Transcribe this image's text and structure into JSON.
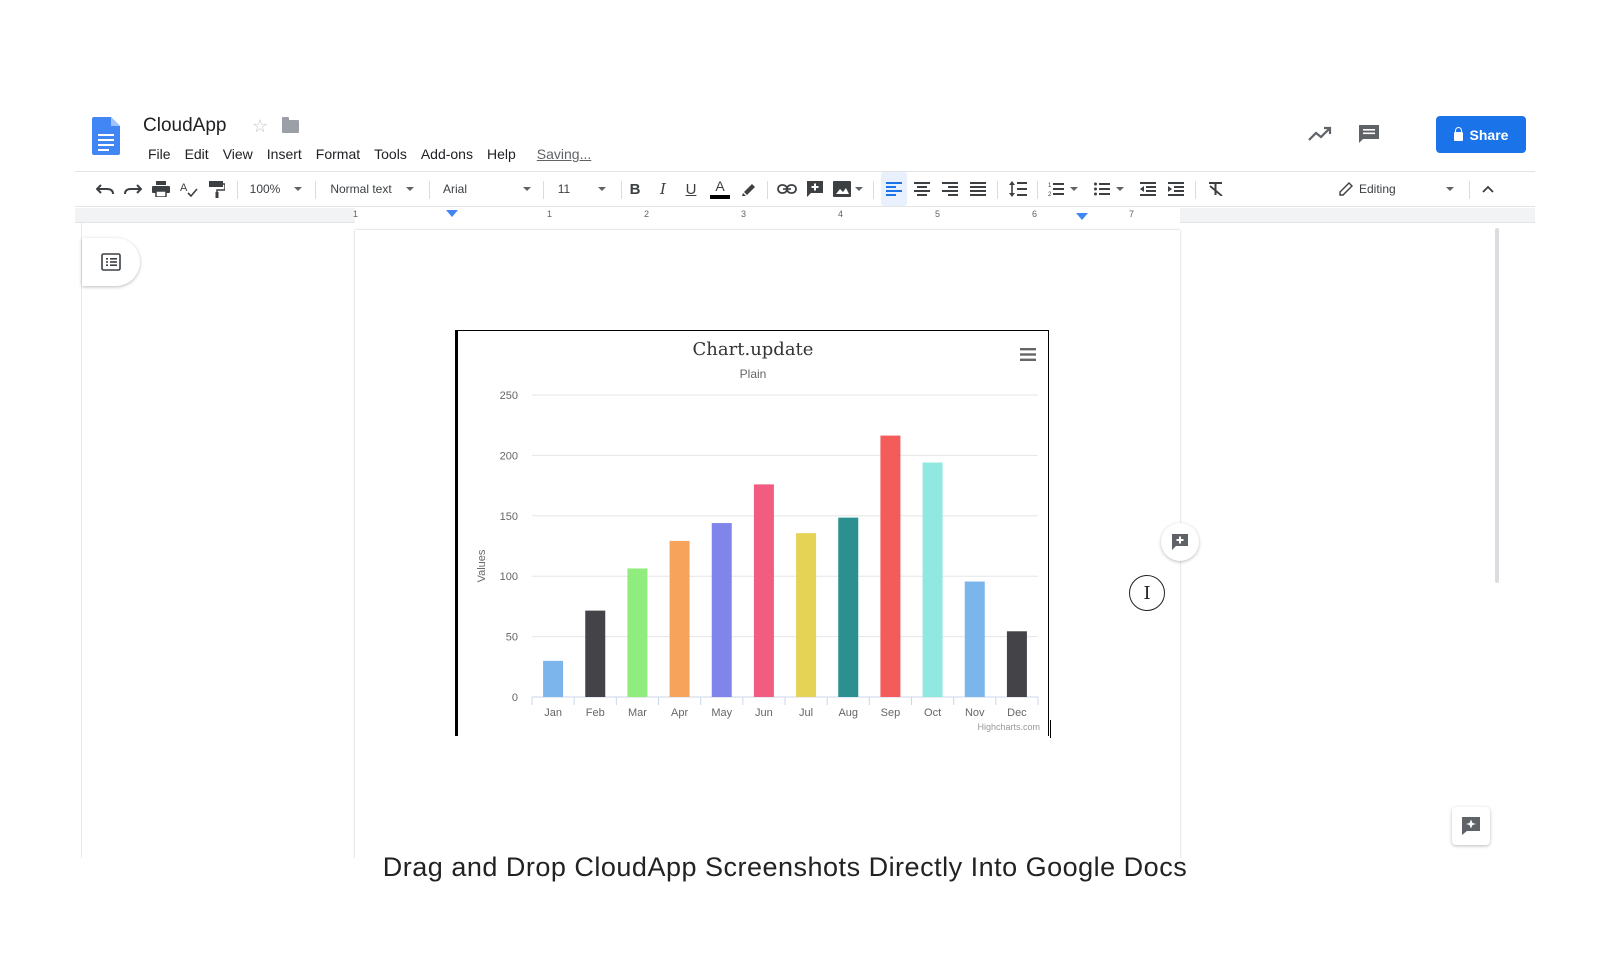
{
  "app": {
    "title": "CloudApp",
    "menu": [
      "File",
      "Edit",
      "View",
      "Insert",
      "Format",
      "Tools",
      "Add-ons",
      "Help"
    ],
    "status": "Saving...",
    "share_label": "Share"
  },
  "toolbar": {
    "zoom": "100%",
    "style": "Normal text",
    "font": "Arial",
    "font_size": "11",
    "mode": "Editing"
  },
  "ruler": {
    "labels": [
      "1",
      "1",
      "2",
      "3",
      "4",
      "5",
      "6",
      "7"
    ]
  },
  "chart_data": {
    "type": "bar",
    "title": "Chart.update",
    "subtitle": "Plain",
    "ylabel": "Values",
    "xlabel": "",
    "ylim": [
      0,
      250
    ],
    "yticks": [
      0,
      50,
      100,
      150,
      200,
      250
    ],
    "categories": [
      "Jan",
      "Feb",
      "Mar",
      "Apr",
      "May",
      "Jun",
      "Jul",
      "Aug",
      "Sep",
      "Oct",
      "Nov",
      "Dec"
    ],
    "values": [
      29.9,
      71.5,
      106.4,
      129.2,
      144.0,
      176.0,
      135.6,
      148.5,
      216.4,
      194.1,
      95.6,
      54.4
    ],
    "colors": [
      "#7cb5ec",
      "#434348",
      "#90ed7d",
      "#f7a35c",
      "#8085e9",
      "#f15c80",
      "#e4d354",
      "#2b908f",
      "#f45b5b",
      "#91e8e1",
      "#7cb5ec",
      "#434348"
    ],
    "grid": true,
    "legend": "none",
    "credit": "Highcharts.com"
  },
  "caption": "Drag and Drop CloudApp Screenshots Directly Into Google Docs"
}
